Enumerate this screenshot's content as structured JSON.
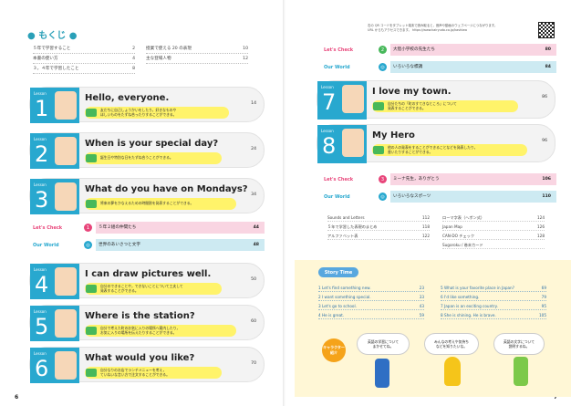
{
  "left": {
    "title": "もくじ",
    "page_number": "6",
    "toc": [
      {
        "t": "５年で学習すること",
        "p": "2"
      },
      {
        "t": "本書の使い方",
        "p": "4"
      },
      {
        "t": "３，４年で学習したこと",
        "p": "8"
      },
      {
        "t": "授業で使える 20 の表現",
        "p": "10"
      },
      {
        "t": "主な登場人物",
        "p": "12"
      }
    ],
    "lessons": [
      {
        "n": "1",
        "t": "Hello, everyone.",
        "g": "友だちに自己しょうかいをしたり，好きなものや\nほしいものをたずね合ったりすることができる。",
        "p": "14",
        "c": "#28a8cf"
      },
      {
        "n": "2",
        "t": "When is your special day?",
        "g": "誕生日や特別な日をたずね合うことができる。",
        "p": "24",
        "c": "#28a8cf"
      },
      {
        "n": "3",
        "t": "What do you have on Mondays?",
        "g": "将来の夢をかなえるための時間割を発表することができる。",
        "p": "34",
        "c": "#28a8cf"
      },
      {
        "n": "4",
        "t": "I can draw pictures well.",
        "g": "自分のできることや，できないことについて工夫して\n発表することができる。",
        "p": "50",
        "c": "#28a8cf"
      },
      {
        "n": "5",
        "t": "Where is the station?",
        "g": "自分で考えた町のお気に入りの場所へ案内したり，\nお気に入りの場所を伝えたりすることができる。",
        "p": "60",
        "c": "#28a8cf"
      },
      {
        "n": "6",
        "t": "What would you like?",
        "g": "自分なりのお店でランチメニューを考え，\nていねいな言い方で注文することができる。",
        "p": "70",
        "c": "#28a8cf"
      }
    ],
    "bands": [
      {
        "l": "Let's Check",
        "n": "1",
        "t": "５年２組の仲間たち",
        "p": "44",
        "bg": "#f9d5e2",
        "c": "#e8457a"
      },
      {
        "l": "Our World",
        "n": "",
        "t": "世界のあいさつと文字",
        "p": "48",
        "bg": "#cdeaf2",
        "c": "#28a8cf"
      }
    ]
  },
  "right": {
    "page_number": "7",
    "qr_note": "右の QR コードをタブレット端末で読み取ると，音声や動画のウェブページにつながります。\nURL からもアクセスできます。 https://www.kairyudo.co.jp/kashiwa",
    "bands1": [
      {
        "l": "Let's Check",
        "n": "2",
        "t": "大陸小学校の先生たち",
        "p": "80",
        "bg": "#f9d5e2"
      },
      {
        "l": "Our World",
        "n": "",
        "t": "いろいろな標識",
        "p": "84",
        "bg": "#cdeaf2"
      }
    ],
    "lessons": [
      {
        "n": "7",
        "t": "I love my town.",
        "g": "自分たちの「町のすてきなところ」について\n発表することができる。",
        "p": "86"
      },
      {
        "n": "8",
        "t": "My Hero",
        "g": "他の人の発表をすることができることなどを発表したり，\n書いたりすることができる。",
        "p": "96"
      }
    ],
    "bands2": [
      {
        "l": "Let's Check",
        "n": "3",
        "t": "ミーナ先生，ありがとう",
        "p": "106",
        "bg": "#f9d5e2"
      },
      {
        "l": "Our World",
        "n": "",
        "t": "いろいろなスポーツ",
        "p": "110",
        "bg": "#cdeaf2"
      }
    ],
    "misc": [
      {
        "t": "Sounds and Letters",
        "p": "112"
      },
      {
        "t": "５年で学習した表現のまとめ",
        "p": "118"
      },
      {
        "t": "アルファベット表",
        "p": "122"
      },
      {
        "t": "ローマ字表（ヘボン式）",
        "p": "124"
      },
      {
        "t": "Japan Map",
        "p": "126"
      },
      {
        "t": "CAN-DO チェック",
        "p": "128"
      },
      {
        "t": "Sugoroku / 巻末カード",
        "p": ""
      }
    ],
    "story": {
      "title": "Story Time",
      "badge": "キャラクター紹介",
      "items": [
        {
          "t": "1  Let's find something new.",
          "p": "23"
        },
        {
          "t": "2  I want something special.",
          "p": "33"
        },
        {
          "t": "3  Let's go to school.",
          "p": "43"
        },
        {
          "t": "4  He is great.",
          "p": "59"
        },
        {
          "t": "5  What is your favorite place in Japan?",
          "p": "69"
        },
        {
          "t": "6  I'd like something.",
          "p": "79"
        },
        {
          "t": "7  Japan is an exciting country.",
          "p": "95"
        },
        {
          "t": "8  She is shining.  He is brave.",
          "p": "105"
        }
      ],
      "bubbles": [
        "英語の学習について\nまかせてね。",
        "みんなの考えや気持ち\nなどを知りたいな。",
        "英語の文字について\n説明するね。"
      ]
    }
  }
}
